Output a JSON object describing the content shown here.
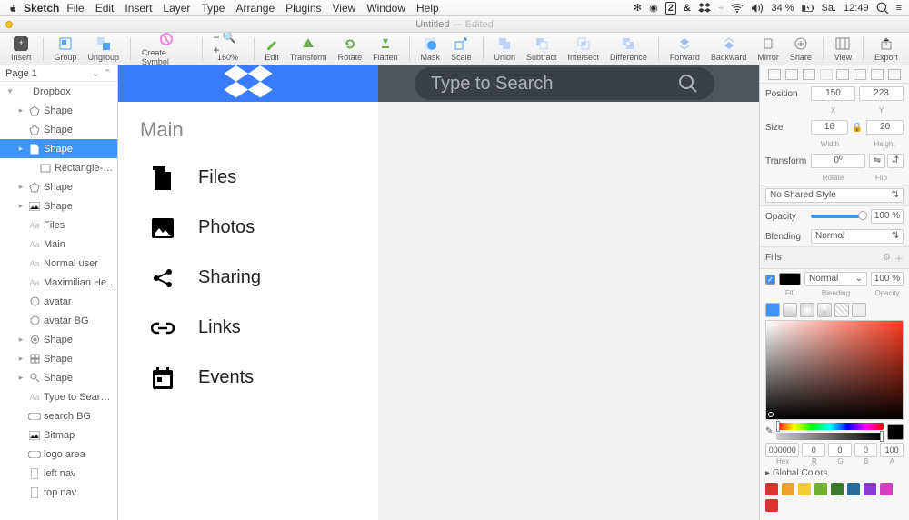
{
  "menubar": {
    "app": "Sketch",
    "items": [
      "File",
      "Edit",
      "Insert",
      "Layer",
      "Type",
      "Arrange",
      "Plugins",
      "View",
      "Window",
      "Help"
    ],
    "battery": "34 %",
    "day": "Sa.",
    "time": "12:49"
  },
  "window": {
    "title": "Untitled",
    "state": "— Edited"
  },
  "toolbar": {
    "items": [
      "Insert",
      "Group",
      "Ungroup",
      "Create Symbol",
      "160%",
      "Edit",
      "Transform",
      "Rotate",
      "Flatten",
      "Mask",
      "Scale",
      "Union",
      "Subtract",
      "Intersect",
      "Difference",
      "Forward",
      "Backward",
      "Mirror",
      "Share",
      "View",
      "Export"
    ]
  },
  "pages": {
    "label": "Page 1"
  },
  "layers": {
    "root": "Dropbox",
    "items": [
      {
        "name": "Shape",
        "ind": 2,
        "tw": "▸",
        "icon": "pent"
      },
      {
        "name": "Shape",
        "ind": 2,
        "tw": "",
        "icon": "pent"
      },
      {
        "name": "Shape",
        "ind": 2,
        "tw": "▸",
        "icon": "page",
        "sel": true
      },
      {
        "name": "Rectangle-path",
        "ind": 3,
        "tw": "",
        "icon": "rect"
      },
      {
        "name": "Shape",
        "ind": 2,
        "tw": "▸",
        "icon": "pent"
      },
      {
        "name": "Shape",
        "ind": 2,
        "tw": "▸",
        "icon": "img"
      },
      {
        "name": "Files",
        "ind": 2,
        "tw": "",
        "icon": "txt"
      },
      {
        "name": "Main",
        "ind": 2,
        "tw": "",
        "icon": "txt"
      },
      {
        "name": "Normal user",
        "ind": 2,
        "tw": "",
        "icon": "txt"
      },
      {
        "name": "Maximilian He…",
        "ind": 2,
        "tw": "",
        "icon": "txt"
      },
      {
        "name": "avatar",
        "ind": 2,
        "tw": "",
        "icon": "circ"
      },
      {
        "name": "avatar BG",
        "ind": 2,
        "tw": "",
        "icon": "circ"
      },
      {
        "name": "Shape",
        "ind": 2,
        "tw": "▸",
        "icon": "gear"
      },
      {
        "name": "Shape",
        "ind": 2,
        "tw": "▸",
        "icon": "grid"
      },
      {
        "name": "Shape",
        "ind": 2,
        "tw": "▸",
        "icon": "mag"
      },
      {
        "name": "Type to Sear…",
        "ind": 2,
        "tw": "",
        "icon": "txt"
      },
      {
        "name": "search BG",
        "ind": 2,
        "tw": "",
        "icon": "pill"
      },
      {
        "name": "Bitmap",
        "ind": 2,
        "tw": "",
        "icon": "img"
      },
      {
        "name": "logo area",
        "ind": 2,
        "tw": "",
        "icon": "pill"
      },
      {
        "name": "left nav",
        "ind": 2,
        "tw": "",
        "icon": "bar"
      },
      {
        "name": "top nav",
        "ind": 2,
        "tw": "",
        "icon": "bar"
      }
    ]
  },
  "canvas": {
    "search_placeholder": "Type to Search",
    "main_heading": "Main",
    "nav": [
      "Files",
      "Photos",
      "Sharing",
      "Links",
      "Events"
    ]
  },
  "inspector": {
    "position": {
      "label": "Position",
      "x": "150",
      "y": "223",
      "xl": "X",
      "yl": "Y"
    },
    "size": {
      "label": "Size",
      "w": "16",
      "h": "20",
      "wl": "Width",
      "hl": "Height"
    },
    "transform": {
      "label": "Transform",
      "rot": "0º",
      "rl": "Rotate",
      "fl": "Flip"
    },
    "shared_style": "No Shared Style",
    "opacity": {
      "label": "Opacity",
      "val": "100 %"
    },
    "blending": {
      "label": "Blending",
      "val": "Normal"
    },
    "fills": {
      "label": "Fills",
      "mode": "Normal",
      "op": "100 %",
      "sub": [
        "Fill",
        "Blending",
        "Opacity"
      ]
    },
    "hex": {
      "hex": "000000",
      "r": "0",
      "g": "0",
      "b": "0",
      "a": "100",
      "labs": [
        "Hex",
        "R",
        "G",
        "B",
        "A"
      ]
    },
    "global": "Global Colors",
    "swatches": [
      "#e03030",
      "#f0a030",
      "#f0d030",
      "#70b030",
      "#3a7a2a",
      "#2a6a9a",
      "#8a3ad0",
      "#d040c0",
      "#e03030"
    ]
  }
}
